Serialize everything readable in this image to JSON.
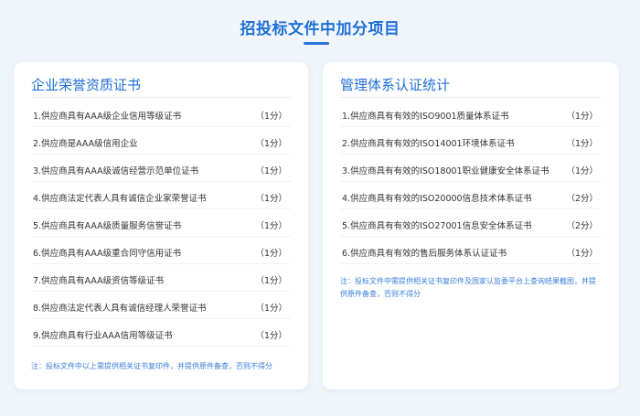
{
  "page": {
    "title": "招投标文件中加分项目"
  },
  "left_card": {
    "title": "企业荣誉资质证书",
    "items": [
      {
        "label": "1.供应商具有AAA级企业信用等级证书",
        "score": "（1分）"
      },
      {
        "label": "2.供应商是AAA级信用企业",
        "score": "（1分）"
      },
      {
        "label": "3.供应商具有AAA级诚信经营示范单位证书",
        "score": "（1分）"
      },
      {
        "label": "4.供应商法定代表人具有诚信企业家荣誉证书",
        "score": "（1分）"
      },
      {
        "label": "5.供应商具有AAA级质量服务信誉证书",
        "score": "（1分）"
      },
      {
        "label": "6.供应商具有AAA级重合同守信用证书",
        "score": "（1分）"
      },
      {
        "label": "7.供应商具有AAA级资信等级证书",
        "score": "（1分）"
      },
      {
        "label": "8.供应商法定代表人具有诚信经理人荣誉证书",
        "score": "（1分）"
      },
      {
        "label": "9.供应商具有行业AAA信用等级证书",
        "score": "（1分）"
      }
    ],
    "note": "注：投标文件中以上需提供相关证书复印件，并提供原件备查，否则不得分"
  },
  "right_card": {
    "title": "管理体系认证统计",
    "items": [
      {
        "label": "1.供应商具有有效的ISO9001质量体系证书",
        "score": "（1分）"
      },
      {
        "label": "2.供应商具有有效的ISO14001环境体系证书",
        "score": "（1分）"
      },
      {
        "label": "3.供应商具有有效的ISO18001职业健康安全体系证书",
        "score": "（1分）"
      },
      {
        "label": "4.供应商具有有效的ISO20000信息技术体系证书",
        "score": "（2分）"
      },
      {
        "label": "5.供应商具有有效的ISO27001信息安全体系证书",
        "score": "（2分）"
      },
      {
        "label": "6.供应商具有有效的售后服务体系认证证书",
        "score": "（1分）"
      }
    ],
    "note": "注：投标文件中需提供相关证书复印件及国家认监委平台上查询结果截图，并提供原件备查，否则不得分"
  },
  "colors": {
    "accent": "#1f6fd6",
    "note": "#3b7fd9",
    "background": "#f1f6fc"
  }
}
